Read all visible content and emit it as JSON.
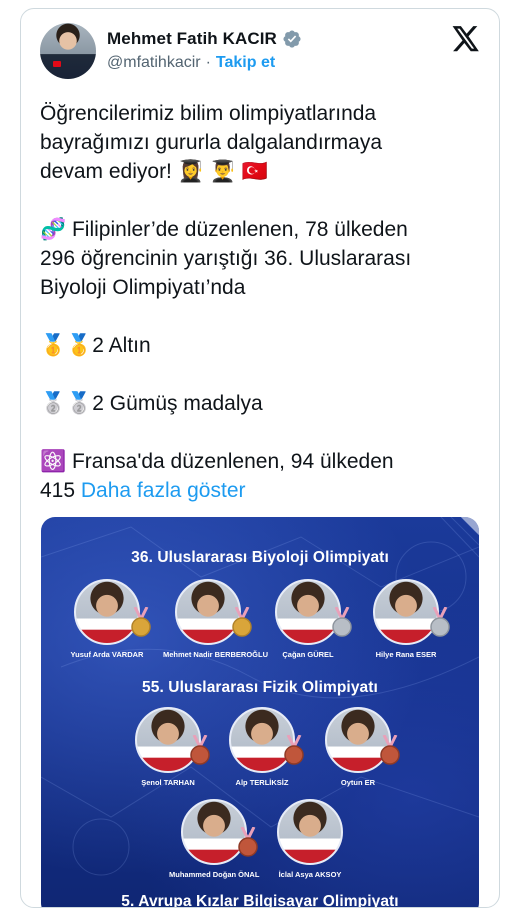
{
  "author": {
    "name": "Mehmet Fatih KACIR",
    "handle": "@mfatihkacir",
    "separator": "·",
    "follow_label": "Takip et"
  },
  "tweet": {
    "line1": "Öğrencilerimiz bilim olimpiyatlarında",
    "line2": "bayrağımızı gururla dalgalandırmaya",
    "line3": "devam ediyor! 👩‍🎓 👨‍🎓 🇹🇷",
    "para2_line1": "🧬 Filipinler’de düzenlenen, 78 ülkeden",
    "para2_line2": "296 öğrencinin yarıştığı 36. Uluslararası",
    "para2_line3": "Biyoloji Olimpiyatı’nda",
    "gold": "🥇🥇2 Altın",
    "silver": "🥈🥈2 Gümüş madalya",
    "para5_line1": "⚛️ Fransa'da düzenlenen, 94 ülkeden",
    "para5_line2": "415",
    "show_more": "Daha fazla göster"
  },
  "media": {
    "section1_title": "36. Uluslararası Biyoloji Olimpiyatı",
    "section2_title": "55. Uluslararası Fizik Olimpiyatı",
    "section3_title": "5. Avrupa Kızlar Bilgisayar Olimpiyatı",
    "biology": [
      {
        "name": "Yusuf Arda VARDAR",
        "medal": "gold"
      },
      {
        "name": "Mehmet Nadir BERBEROĞLU",
        "medal": "gold"
      },
      {
        "name": "Çağan GÜREL",
        "medal": "silver"
      },
      {
        "name": "Hilye Rana ESER",
        "medal": "silver"
      }
    ],
    "physics": [
      {
        "name": "Şenol TARHAN",
        "medal": "bronze"
      },
      {
        "name": "Alp TERLİKSİZ",
        "medal": "bronze"
      },
      {
        "name": "Oytun ER",
        "medal": "bronze"
      },
      {
        "name": "Muhammed Doğan ÖNAL",
        "medal": "bronze"
      },
      {
        "name": "İclal Asya AKSOY",
        "medal": "none"
      }
    ]
  },
  "colors": {
    "link": "#1d9bf0",
    "verified": "#829aab",
    "gold": "#d9a53a",
    "silver": "#b8bec6",
    "bronze": "#c0563b",
    "ribbon": "#e9a0b9"
  },
  "icons": {
    "verified": "verified-badge-icon",
    "x_logo": "x-logo-icon"
  }
}
